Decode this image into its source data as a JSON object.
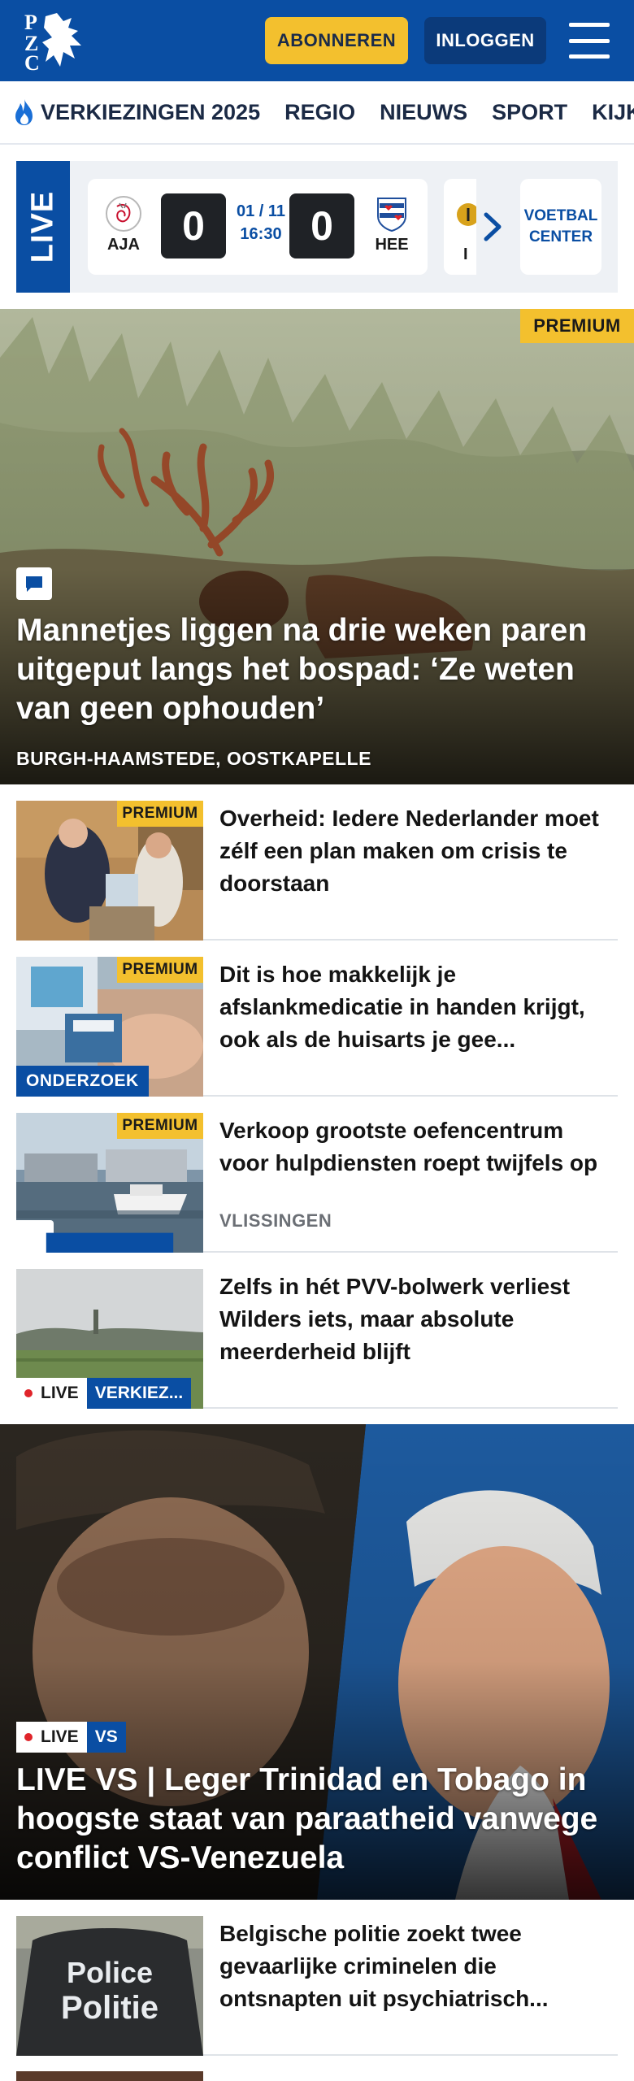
{
  "header": {
    "logo_text": "PZC",
    "subscribe_label": "ABONNEREN",
    "login_label": "INLOGGEN"
  },
  "nav": {
    "items": [
      {
        "label": "VERKIEZINGEN 2025",
        "icon": "flame-icon"
      },
      {
        "label": "REGIO"
      },
      {
        "label": "NIEUWS"
      },
      {
        "label": "SPORT"
      },
      {
        "label": "KIJK"
      }
    ]
  },
  "live_scores": {
    "tab_label": "LIVE",
    "match": {
      "home": "AJA",
      "away": "HEE",
      "home_score": "0",
      "away_score": "0",
      "date": "01 / 11",
      "time": "16:30"
    },
    "next_partial": "I",
    "center_label_line1": "VOETBAL",
    "center_label_line2": "CENTER"
  },
  "hero": {
    "premium": "PREMIUM",
    "title": "Mannetjes liggen na drie weken paren uitgeput langs het bospad: ‘Ze weten van geen ophouden’",
    "location": "BURGH-HAAMSTEDE, OOSTKAPELLE"
  },
  "articles": [
    {
      "premium": "PREMIUM",
      "title": "Overheid: Iedere Nederlander moet zélf een plan maken om crisis te doorstaan"
    },
    {
      "premium": "PREMIUM",
      "label": "ONDERZOEK",
      "title": "Dit is hoe makkelijk je afslankmedicatie in handen krijgt, ook als de huisarts je gee..."
    },
    {
      "premium": "PREMIUM",
      "title": "Verkoop grootste oefencentrum voor hulpdiensten roept twijfels op",
      "location": "VLISSINGEN"
    },
    {
      "live": "LIVE",
      "tag": "VERKIEZ...",
      "title": "Zelfs in hét PVV-bolwerk verliest Wilders iets, maar absolute meerderheid blijft"
    }
  ],
  "big_article": {
    "live": "LIVE",
    "tag": "VS",
    "title": "LIVE VS | Leger Trinidad en Tobago in hoogste staat van paraatheid vanwege conflict VS-Venezuela"
  },
  "article_police": {
    "title": "Belgische politie zoekt twee gevaarlijke criminelen die ontsnapten uit psychiatrisch...",
    "image_text_line1": "Police",
    "image_text_line2": "Politie"
  },
  "colors": {
    "brand_blue": "#0a4ea3",
    "premium_yellow": "#f3c02e",
    "live_red": "#e0242a"
  }
}
